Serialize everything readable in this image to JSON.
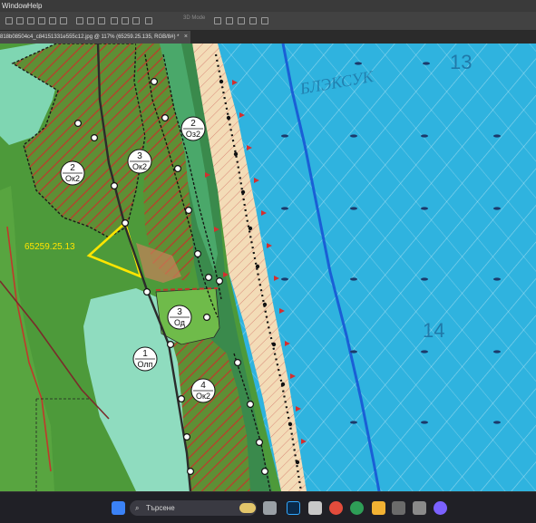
{
  "menu": {
    "items": [
      "Window",
      "Help"
    ]
  },
  "options": {
    "mode_label": "3D Mode"
  },
  "tab": {
    "title": "818b08504c4_c84151331e555c12.jpg @ 117% (65259.25.135, RGB/8#) *",
    "close": "×"
  },
  "map": {
    "zones": [
      {
        "top": "2",
        "bottom": "Ок2"
      },
      {
        "top": "3",
        "bottom": "Ок2"
      },
      {
        "top": "2",
        "bottom": "Оз2"
      },
      {
        "top": "3",
        "bottom": "Од"
      },
      {
        "top": "1",
        "bottom": "Олп"
      },
      {
        "top": "4",
        "bottom": "Ок2"
      }
    ],
    "parcel_label": "65259.25.13",
    "sea_numbers": [
      "13",
      "14"
    ],
    "sea_name": "БЛЭКСУК"
  },
  "taskbar": {
    "search_placeholder": "Търсене"
  },
  "colors": {
    "sea": "#2fb3df",
    "forest": "#5aa83e",
    "hatch": "#c0392b",
    "meadow": "#7fd6b2",
    "beach": "#f0d9b5",
    "highlight": "#ffe500"
  }
}
